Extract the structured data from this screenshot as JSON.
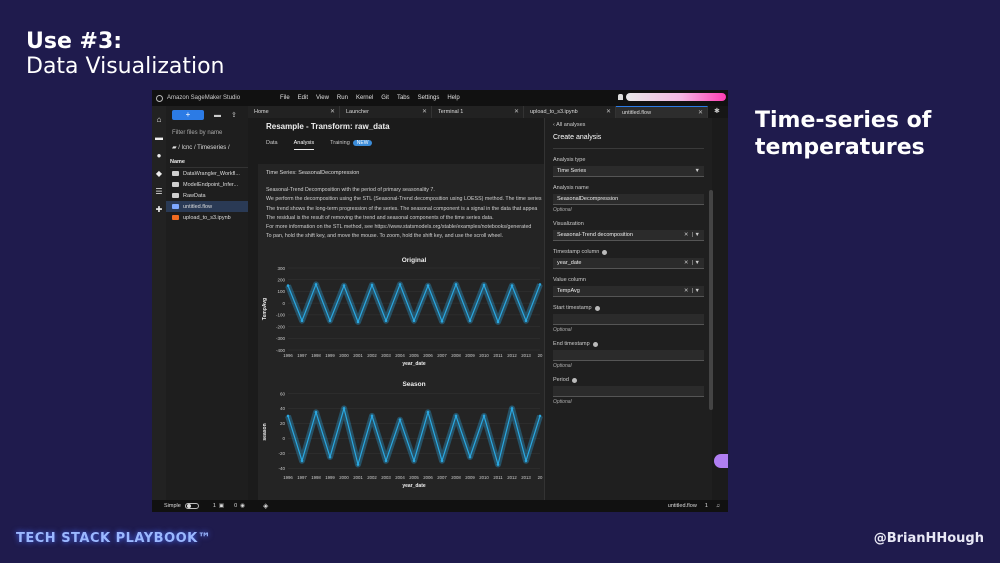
{
  "slide": {
    "title_line1": "Use #3:",
    "title_line2": "Data Visualization",
    "caption": "Time-series of temperatures",
    "footer_left": "TECH STACK PLAYBOOK™",
    "footer_right": "@BrianHHough"
  },
  "app": {
    "brand": "Amazon SageMaker Studio",
    "menus": [
      "File",
      "Edit",
      "View",
      "Run",
      "Kernel",
      "Git",
      "Tabs",
      "Settings",
      "Help"
    ]
  },
  "file_browser": {
    "new_label": "+",
    "filter_placeholder": "Filter files by name",
    "breadcrumb": "/ lcnc / Timeseries /",
    "column_name": "Name",
    "files": [
      {
        "name": "DataWrangler_Workfl...",
        "type": "folder"
      },
      {
        "name": "ModelEndpoint_Infer...",
        "type": "folder"
      },
      {
        "name": "RawData",
        "type": "folder"
      },
      {
        "name": "untitled.flow",
        "type": "flow"
      },
      {
        "name": "upload_to_s3.ipynb",
        "type": "notebook"
      }
    ]
  },
  "tabs": [
    {
      "label": "Home",
      "active": false
    },
    {
      "label": "Launcher",
      "active": false
    },
    {
      "label": "Terminal 1",
      "active": false
    },
    {
      "label": "upload_to_s3.ipynb",
      "active": false
    },
    {
      "label": "untitled.flow",
      "active": true
    }
  ],
  "flow": {
    "title": "Resample - Transform: raw_data",
    "subtabs": [
      "Data",
      "Analysis",
      "Training"
    ],
    "new_badge": "NEW"
  },
  "analysis": {
    "title": "Time Series: SeasonalDecompression",
    "paragraphs": [
      "Seasonal-Trend Decomposition with the period of primary seasonality 7.",
      "We perform the decomposition using the STL (Seasonal-Trend decomposition using LOESS) method. The time series",
      "The trend shows the long-term progression of the series. The seasonal component is a signal in the data that appea",
      "The residual is the result of removing the trend and seasonal components of the time series data.",
      "For more information on the STL method, see https://www.statsmodels.org/stable/examples/notebooks/generated",
      "To pan, hold the shift key, and move the mouse. To zoom, hold the shift key, and use the scroll wheel."
    ]
  },
  "chart_data": [
    {
      "type": "line",
      "title": "Original",
      "xlabel": "year_date",
      "ylabel": "TempAvg",
      "x_ticks": [
        "1996",
        "1997",
        "1998",
        "1999",
        "2000",
        "2001",
        "2002",
        "2003",
        "2004",
        "2005",
        "2006",
        "2007",
        "2008",
        "2009",
        "2010",
        "2011",
        "2012",
        "2013",
        "20"
      ],
      "y_ticks": [
        300,
        200,
        100,
        0,
        -100,
        -200,
        -300,
        -400
      ],
      "ylim": [
        -400,
        300
      ],
      "series": [
        {
          "values": [
            150,
            -150,
            160,
            -150,
            150,
            -160,
            155,
            -150,
            160,
            -150,
            150,
            -155,
            160,
            -150,
            155,
            -160,
            150,
            -150,
            160
          ]
        }
      ],
      "color": "#2aa7e0"
    },
    {
      "type": "line",
      "title": "Season",
      "xlabel": "year_date",
      "ylabel": "season",
      "x_ticks": [
        "1996",
        "1997",
        "1998",
        "1999",
        "2000",
        "2001",
        "2002",
        "2003",
        "2004",
        "2005",
        "2006",
        "2007",
        "2008",
        "2009",
        "2010",
        "2011",
        "2012",
        "2013",
        "20"
      ],
      "y_ticks": [
        60,
        40,
        20,
        0,
        -20,
        -40
      ],
      "ylim": [
        -45,
        62
      ],
      "series": [
        {
          "values": [
            30,
            -30,
            35,
            -25,
            40,
            -35,
            30,
            -30,
            25,
            -30,
            35,
            -30,
            30,
            -25,
            30,
            -35,
            40,
            -30,
            30
          ]
        }
      ],
      "color": "#2aa7e0"
    }
  ],
  "create_analysis": {
    "back_label": "All analyses",
    "title": "Create analysis",
    "fields": [
      {
        "label": "Analysis type",
        "value": "Time Series",
        "control": "dropdown"
      },
      {
        "label": "Analysis name",
        "value": "SeasonalDecompression",
        "note": "Optional"
      },
      {
        "label": "Visualization",
        "value": "Seasonal-Trend decomposition",
        "control": "clear-dropdown"
      },
      {
        "label": "Timestamp column",
        "value": "year_date",
        "control": "clear-dropdown",
        "info": true
      },
      {
        "label": "Value column",
        "value": "TempAvg",
        "control": "clear-dropdown"
      },
      {
        "label": "Start timestamp",
        "value": "",
        "note": "Optional",
        "info": true
      },
      {
        "label": "End timestamp",
        "value": "",
        "note": "Optional",
        "info": true
      },
      {
        "label": "Period",
        "value": "",
        "note": "Optional",
        "info": true
      }
    ]
  },
  "status_bar": {
    "mode": "Simple",
    "count1": "1",
    "count2": "0",
    "file": "untitled.flow",
    "line": "1"
  }
}
